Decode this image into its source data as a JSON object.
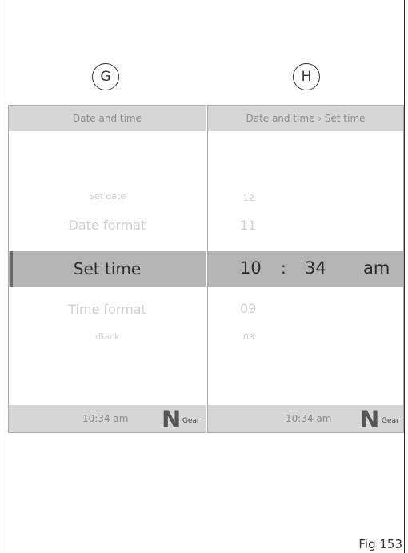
{
  "labels": {
    "left": "G",
    "right": "H"
  },
  "left_panel": {
    "header": "Date and time",
    "items": {
      "set_date": "Set date",
      "date_format": "Date format",
      "set_time": "Set time",
      "time_format": "Time format",
      "back": "‹Back"
    },
    "footer_time": "10:34 am",
    "gear_letter": "N",
    "gear_text": "Gear"
  },
  "right_panel": {
    "header": "Date and time › Set time",
    "numbers": {
      "n12": "12",
      "n11": "11",
      "n09": "09",
      "n08": "08"
    },
    "selected": {
      "hour": "10",
      "separator": ":",
      "minute": "34",
      "ampm": "am"
    },
    "footer_time": "10:34 am",
    "gear_letter": "N",
    "gear_text": "Gear"
  },
  "figure_label": "Fig 153",
  "colors": {
    "header_bg": "#d6d6d6",
    "selected_bg": "#b4b4b4",
    "faded_text": "#cfcfcf"
  }
}
